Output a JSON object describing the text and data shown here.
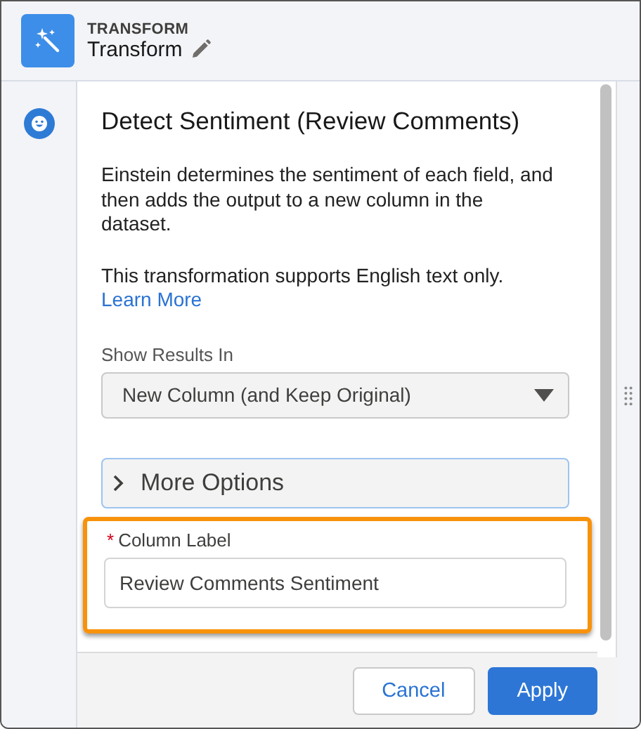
{
  "header": {
    "eyebrow": "TRANSFORM",
    "title": "Transform"
  },
  "panel": {
    "title": "Detect Sentiment (Review Comments)",
    "description": "Einstein determines the sentiment of each field, and then adds the output to a new column in the dataset.",
    "note": "This transformation supports English text only.",
    "link": "Learn More"
  },
  "show_results": {
    "label": "Show Results In",
    "value": "New Column (and Keep Original)"
  },
  "more_options": {
    "label": "More Options",
    "expanded": false
  },
  "column_label": {
    "label": "Column Label",
    "required": true,
    "required_mark": "*",
    "value": "Review Comments Sentiment",
    "highlighted": true
  },
  "buttons": [
    {
      "label": "Cancel",
      "kind": "neutral"
    },
    {
      "label": "Apply",
      "kind": "brand"
    }
  ]
}
